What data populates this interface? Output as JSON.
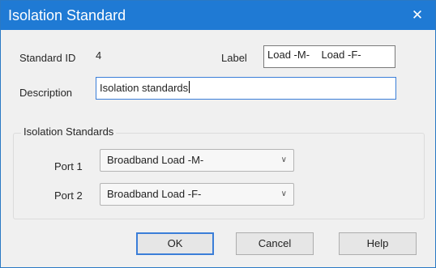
{
  "window": {
    "title": "Isolation Standard",
    "close_glyph": "✕"
  },
  "form": {
    "standard_id_label": "Standard ID",
    "standard_id_value": "4",
    "label_label": "Label",
    "label_value": "Load -M-    Load -F-",
    "description_label": "Description",
    "description_value": "Isolation standards"
  },
  "group": {
    "title": "Isolation Standards",
    "ports": [
      {
        "label": "Port 1",
        "selected": "Broadband Load -M-"
      },
      {
        "label": "Port 2",
        "selected": "Broadband Load -F-"
      }
    ]
  },
  "buttons": {
    "ok": "OK",
    "cancel": "Cancel",
    "help": "Help"
  },
  "icons": {
    "dropdown": "chevron-down-icon",
    "close": "close-icon"
  },
  "colors": {
    "titlebar": "#1f7ad4",
    "focus_border": "#3b7ed8"
  }
}
